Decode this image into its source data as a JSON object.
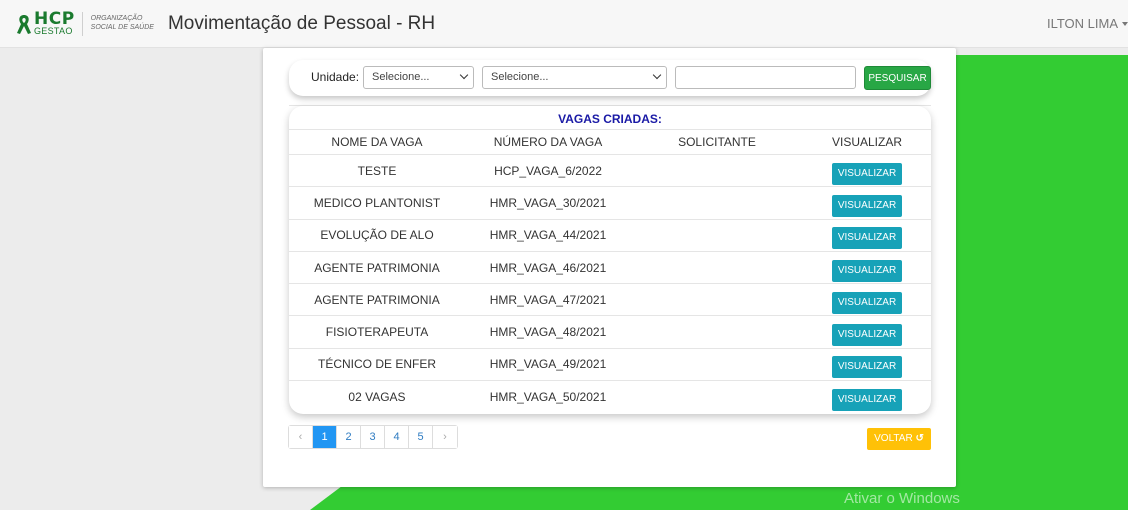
{
  "navbar": {
    "logo_main": "HCP",
    "logo_sub": "GESTAO",
    "logo_org_line1": "ORGANIZAÇÃO",
    "logo_org_line2": "SOCIAL DE SAÚDE",
    "title": "Movimentação de Pessoal - RH",
    "user": "ILTON LIMA"
  },
  "filters": {
    "unit_label": "Unidade:",
    "select1_value": "Selecione...",
    "select2_value": "Selecione...",
    "search_value": "",
    "search_button": "PESQUISAR"
  },
  "table": {
    "heading": "VAGAS CRIADAS:",
    "columns": [
      "NOME DA VAGA",
      "NÚMERO DA VAGA",
      "SOLICITANTE",
      "VISUALIZAR"
    ],
    "rows": [
      {
        "name": "TESTE",
        "number": "HCP_VAGA_6/2022",
        "requester": "",
        "action": "VISUALIZAR"
      },
      {
        "name": "MEDICO PLANTONIST",
        "number": "HMR_VAGA_30/2021",
        "requester": "",
        "action": "VISUALIZAR"
      },
      {
        "name": "EVOLUÇÃO DE ALO",
        "number": "HMR_VAGA_44/2021",
        "requester": "",
        "action": "VISUALIZAR"
      },
      {
        "name": "AGENTE PATRIMONIA",
        "number": "HMR_VAGA_46/2021",
        "requester": "",
        "action": "VISUALIZAR"
      },
      {
        "name": "AGENTE PATRIMONIA",
        "number": "HMR_VAGA_47/2021",
        "requester": "",
        "action": "VISUALIZAR"
      },
      {
        "name": "FISIOTERAPEUTA",
        "number": "HMR_VAGA_48/2021",
        "requester": "",
        "action": "VISUALIZAR"
      },
      {
        "name": "TÉCNICO DE ENFER",
        "number": "HMR_VAGA_49/2021",
        "requester": "",
        "action": "VISUALIZAR"
      },
      {
        "name": "02 VAGAS",
        "number": "HMR_VAGA_50/2021",
        "requester": "",
        "action": "VISUALIZAR"
      }
    ]
  },
  "pagination": {
    "prev": "‹",
    "pages": [
      "1",
      "2",
      "3",
      "4",
      "5"
    ],
    "active_page": "1",
    "next": "›"
  },
  "back_button": "VOLTAR",
  "watermark": "Ativar o Windows",
  "colors": {
    "green_bg": "#33cc33",
    "search_button": "#28a745",
    "view_button": "#17a2b8",
    "back_button": "#ffc107",
    "heading": "#1a1aa6",
    "active_page": "#2196f3"
  }
}
